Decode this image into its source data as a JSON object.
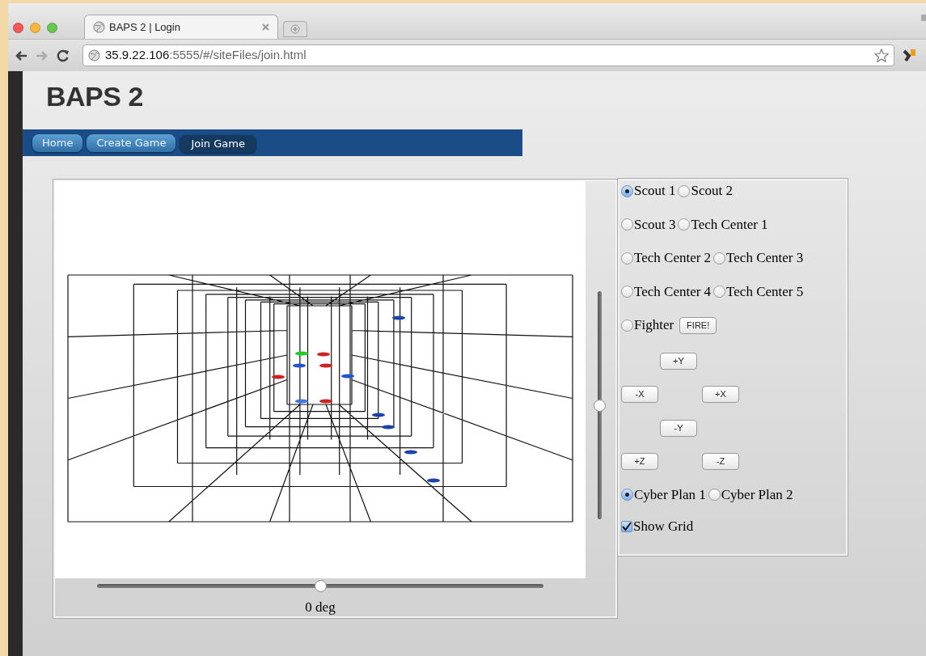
{
  "browser": {
    "tab_title": "BAPS 2 | Login",
    "url_host": "35.9.22.106",
    "url_path": ":5555/#/siteFiles/join.html"
  },
  "page": {
    "title": "BAPS 2",
    "nav": [
      {
        "label": "Home",
        "selected": false
      },
      {
        "label": "Create Game",
        "selected": false
      },
      {
        "label": "Join Game",
        "selected": true
      }
    ]
  },
  "view": {
    "vertical_slider": {
      "level": 0.5
    },
    "rotation_slider": {
      "level": 0.5
    },
    "angle_label": "0 deg"
  },
  "units": [
    {
      "label": "Scout 1",
      "selected": true
    },
    {
      "label": "Scout 2",
      "selected": false
    },
    {
      "label": "Scout 3",
      "selected": false
    },
    {
      "label": "Tech Center 1",
      "selected": false
    },
    {
      "label": "Tech Center 2",
      "selected": false
    },
    {
      "label": "Tech Center 3",
      "selected": false
    },
    {
      "label": "Tech Center 4",
      "selected": false
    },
    {
      "label": "Tech Center 5",
      "selected": false
    },
    {
      "label": "Fighter",
      "selected": false
    }
  ],
  "fire_button": "FIRE!",
  "direction_pad": {
    "up": "+Y",
    "left": "-X",
    "right": "+X",
    "down": "-Y"
  },
  "depth_buttons": [
    "+Z",
    "-Z"
  ],
  "plans": [
    {
      "label": "Cyber Plan 1",
      "selected": true
    },
    {
      "label": "Cyber Plan 2",
      "selected": false
    }
  ],
  "show_grid": {
    "label": "Show Grid",
    "checked": true
  }
}
